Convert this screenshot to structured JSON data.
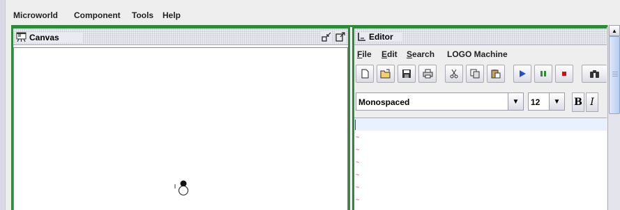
{
  "menubar": {
    "items": [
      "Microworld",
      "Component",
      "Tools",
      "Help"
    ]
  },
  "canvas": {
    "title": "Canvas",
    "title_icon": "easel-icon",
    "controls": [
      "minimize-icon",
      "maximize-icon"
    ],
    "turtle_icon": "turtle-icon"
  },
  "editor": {
    "title": "Editor",
    "title_icon": "editor-icon",
    "menu": {
      "file": {
        "mnemonic": "F",
        "rest": "ile"
      },
      "edit": {
        "mnemonic": "E",
        "rest": "dit"
      },
      "search": {
        "mnemonic": "S",
        "rest": "earch"
      },
      "logo_machine": "LOGO Machine"
    },
    "toolbar": [
      "new-file-icon",
      "open-folder-icon",
      "save-icon",
      "print-icon",
      "cut-icon",
      "copy-icon",
      "paste-icon",
      "run-icon",
      "pause-icon",
      "stop-icon",
      "find-icon"
    ],
    "font_family": "Monospaced",
    "font_size": "12",
    "bold_label": "B",
    "italic_label": "I",
    "line_markers": [
      "~",
      "~",
      "~",
      "~",
      "~",
      "~",
      "~"
    ]
  },
  "colors": {
    "frame_border": "#2f8a3c",
    "run": "#1f4fd6",
    "pause": "#2b8f2b",
    "stop": "#cc1111",
    "caret": "#dd0000",
    "current_line": "#e8f2fe"
  }
}
